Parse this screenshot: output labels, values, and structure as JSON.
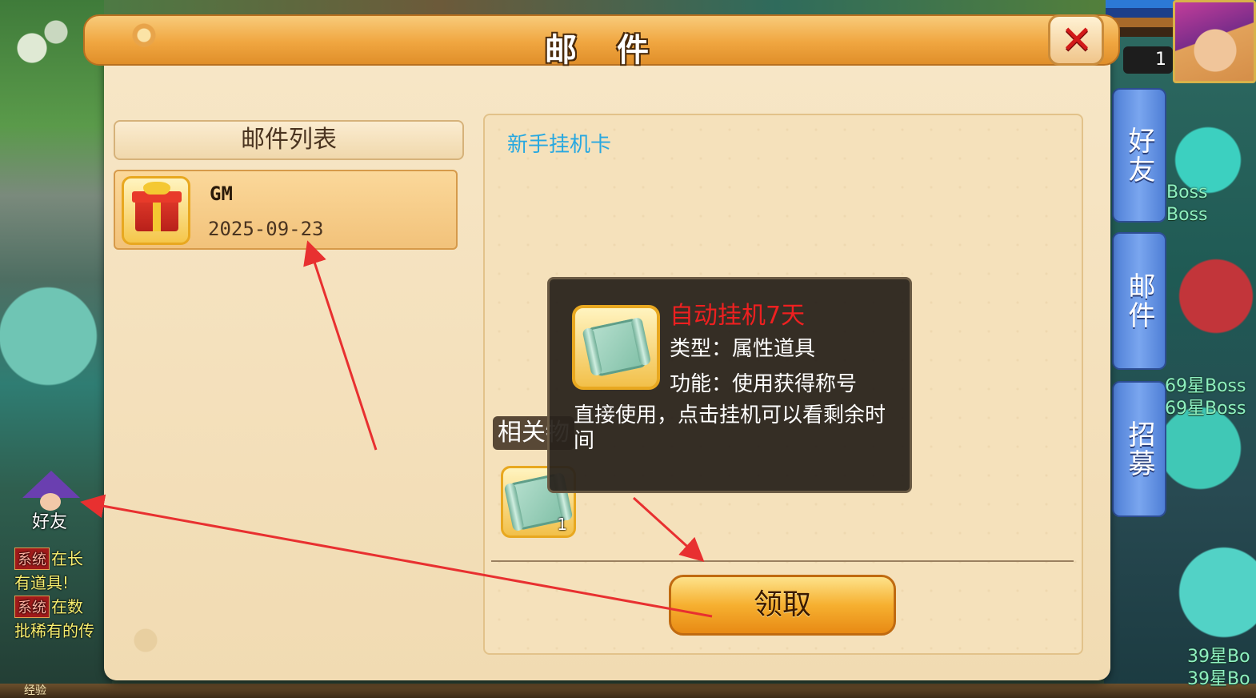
{
  "dialog": {
    "title": "邮 件"
  },
  "mail_list": {
    "header": "邮件列表",
    "items": [
      {
        "sender": "GM",
        "date": "2025-09-23",
        "icon": "gift-box-icon"
      }
    ]
  },
  "mail_detail": {
    "subject": "新手挂机卡",
    "related_label": "相关物",
    "attachment": {
      "icon": "scroll-icon",
      "count": "1"
    },
    "claim_label": "领取"
  },
  "tooltip": {
    "name": "自动挂机7天",
    "type_line": "类型：属性道具",
    "function_line": "功能：使用获得称号",
    "description": "直接使用，点击挂机可以看剩余时间"
  },
  "side_tabs": [
    {
      "label": "好友"
    },
    {
      "label": "邮件"
    },
    {
      "label": "招募"
    }
  ],
  "hud": {
    "level": "1"
  },
  "boss_labels": [
    "Boss",
    "Boss",
    "69星Boss",
    "69星Boss",
    "39星Bo",
    "39星Bo"
  ],
  "left_panel": {
    "friend_label": "好友",
    "chat": [
      {
        "badge": "系统",
        "text": "在长"
      },
      {
        "badge": "",
        "text": "有道具!"
      },
      {
        "badge": "系统",
        "text": "在数"
      },
      {
        "badge": "",
        "text": "批稀有的传"
      }
    ]
  },
  "bottom": {
    "label": "经验"
  },
  "colors": {
    "accent_orange": "#f0a640",
    "tooltip_name": "#ee2020",
    "subject_blue": "#28a8e0",
    "annotation_red": "#e83030"
  }
}
